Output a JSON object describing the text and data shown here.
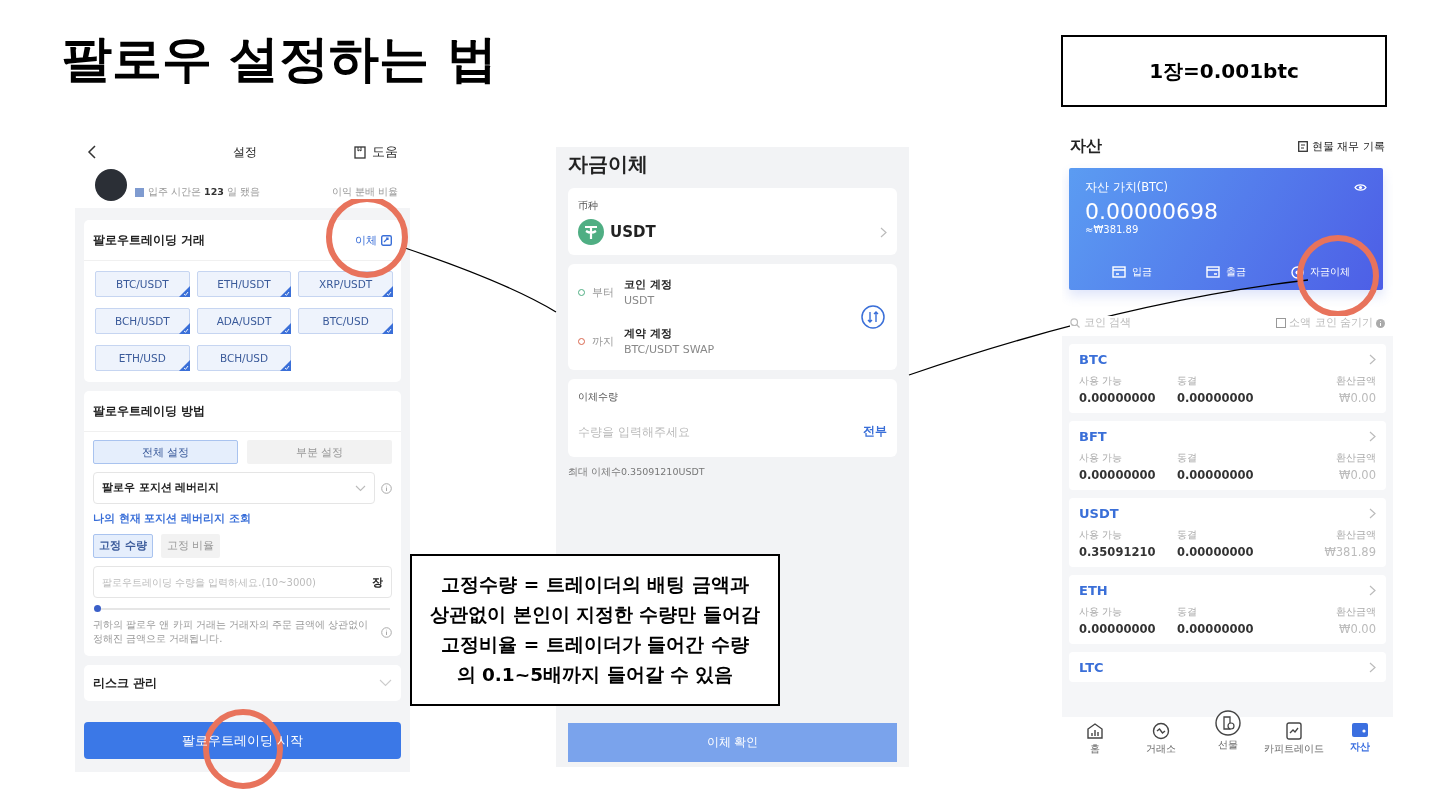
{
  "slide_title": "팔로우 설정하는 법",
  "note_box": "1장=0.001btc",
  "follow_screen": {
    "title": "설정",
    "help": "도움",
    "tenure": "입주 시간은 **123** 일 됐음",
    "profit_label": "이익 분배 비율",
    "pairs_section": {
      "title": "팔로우트레이딩 거래",
      "transfer_link": "이체",
      "pairs": [
        {
          "label": "BTC/USDT",
          "checked": true
        },
        {
          "label": "ETH/USDT",
          "checked": true
        },
        {
          "label": "XRP/USDT",
          "checked": true
        },
        {
          "label": "BCH/USDT",
          "checked": true
        },
        {
          "label": "ADA/USDT",
          "checked": true
        },
        {
          "label": "BTC/USD",
          "checked": true
        },
        {
          "label": "ETH/USD",
          "checked": true
        },
        {
          "label": "BCH/USD",
          "checked": true
        }
      ]
    },
    "method_section": {
      "title": "팔로우트레이딩 방법",
      "tabs": [
        {
          "label": "전체 설정",
          "selected": true
        },
        {
          "label": "부분 설정",
          "selected": false
        }
      ],
      "leverage_select": "팔로우 포지션 레버리지",
      "leverage_link": "나의 현재 포지션 레버리지 조회",
      "modes": [
        {
          "label": "고정 수량",
          "selected": true
        },
        {
          "label": "고정 비율",
          "selected": false
        }
      ],
      "amount_placeholder": "팔로우트레이딩 수량을 입력하세요.(10~3000)",
      "amount_unit": "장",
      "slider": {
        "level": 0
      },
      "note": "귀하의 팔로우 앤 카피 거래는 거래자의 주문 금액에 상관없이 정해진 금액으로 거래됩니다."
    },
    "risk_section": "리스크 관리",
    "start_button": "팔로우트레이딩 시작"
  },
  "transfer_screen": {
    "title": "자금이체",
    "currency_label": "币种",
    "currency": "USDT",
    "from_label": "부터",
    "from_account": "코인 계정",
    "from_sub": "USDT",
    "to_label": "까지",
    "to_account": "계약 계정",
    "to_sub": "BTC/USDT SWAP",
    "amount_label": "이체수량",
    "amount_placeholder": "수량을 입력해주세요",
    "all_button": "전부",
    "max_note": "최대 이체수0.35091210USDT",
    "confirm_button": "이체 확인"
  },
  "assets_screen": {
    "title": "자산",
    "records_link": "현물 재무 기록",
    "card": {
      "label": "자산 가치(BTC)",
      "value": "0.00000698",
      "fiat": "≈₩381.89",
      "actions": [
        {
          "label": "입금",
          "kind": "deposit"
        },
        {
          "label": "출금",
          "kind": "withdraw"
        },
        {
          "label": "자금이체",
          "kind": "transfer"
        }
      ]
    },
    "search_placeholder": "코인 검색",
    "hide_small": {
      "label": "소액 코인 숨기기",
      "checked": false
    },
    "coins": [
      {
        "symbol": "BTC",
        "available_label": "사용 가능",
        "available": "0.00000000",
        "frozen_label": "동결",
        "frozen": "0.00000000",
        "value_label": "환산금액",
        "value": "₩0.00"
      },
      {
        "symbol": "BFT",
        "available_label": "사용 가능",
        "available": "0.00000000",
        "frozen_label": "동결",
        "frozen": "0.00000000",
        "value_label": "환산금액",
        "value": "₩0.00"
      },
      {
        "symbol": "USDT",
        "available_label": "사용 가능",
        "available": "0.35091210",
        "frozen_label": "동결",
        "frozen": "0.00000000",
        "value_label": "환산금액",
        "value": "₩381.89"
      },
      {
        "symbol": "ETH",
        "available_label": "사용 가능",
        "available": "0.00000000",
        "frozen_label": "동결",
        "frozen": "0.00000000",
        "value_label": "환산금액",
        "value": "₩0.00"
      }
    ],
    "partial_coin": "LTC",
    "tabs": [
      {
        "label": "홈",
        "kind": "home",
        "selected": false
      },
      {
        "label": "거래소",
        "kind": "exchange",
        "selected": false
      },
      {
        "label": "선물",
        "kind": "futures",
        "selected": false
      },
      {
        "label": "카피트레이드",
        "kind": "copy",
        "selected": false
      },
      {
        "label": "자산",
        "kind": "wallet",
        "selected": true
      }
    ]
  },
  "callout": [
    "고정수량 = 트레이더의 배팅 금액과",
    "상관없이 본인이 지정한 수량만 들어감",
    "고정비율 = 트레이더가 들어간 수량",
    "의 0.1~5배까지 들어갈 수 있음"
  ]
}
